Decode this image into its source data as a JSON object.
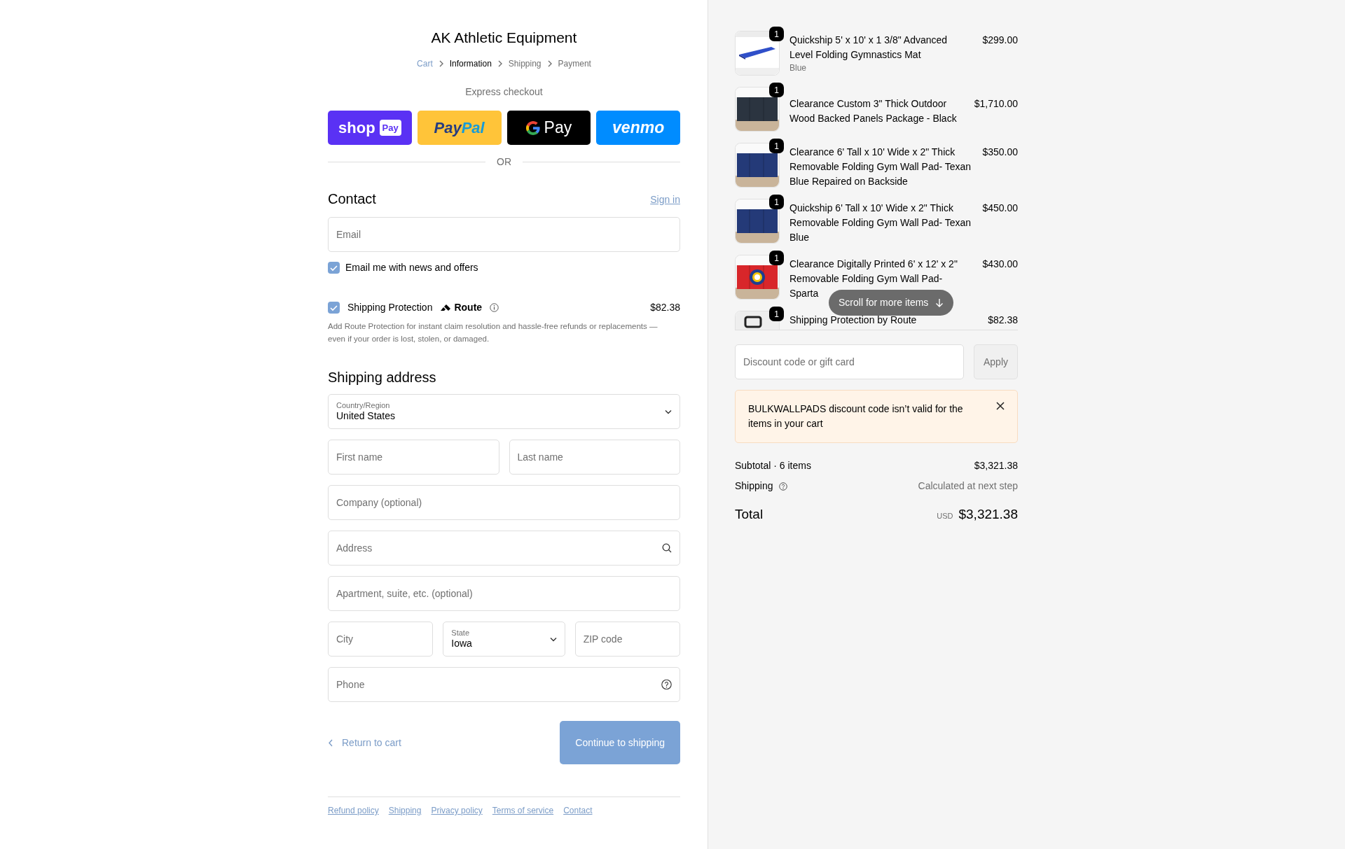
{
  "store": {
    "name": "AK Athletic Equipment"
  },
  "breadcrumb": [
    {
      "label": "Cart",
      "selected": false,
      "link": true
    },
    {
      "label": "Information",
      "selected": true,
      "link": false
    },
    {
      "label": "Shipping",
      "selected": false,
      "link": false
    },
    {
      "label": "Payment",
      "selected": false,
      "link": false
    }
  ],
  "express_checkout": {
    "title": "Express checkout",
    "divider": "OR",
    "buttons": [
      {
        "kind": "shoppay",
        "label": "shop",
        "badge": "Pay"
      },
      {
        "kind": "paypal",
        "label": "Pay",
        "label_2": "Pal"
      },
      {
        "kind": "gpay",
        "label": "Pay"
      },
      {
        "kind": "venmo",
        "label": "venmo"
      }
    ]
  },
  "contact": {
    "title": "Contact",
    "sign_in": "Sign in",
    "email": {
      "placeholder": "Email"
    },
    "newsletter": {
      "label": "Email me with news and offers",
      "checked": true
    }
  },
  "shipping_protection": {
    "label": "Shipping Protection",
    "brand": "Route",
    "price": "$82.38",
    "checked": true,
    "description": "Add Route Protection for instant claim resolution and hassle-free refunds or replacements — even if your order is lost, stolen, or damaged."
  },
  "shipping_address": {
    "title": "Shipping address",
    "rows": [
      [
        {
          "kind": "select",
          "label": "Country/Region",
          "value": "United States"
        }
      ],
      [
        {
          "kind": "text",
          "placeholder": "First name"
        },
        {
          "kind": "text",
          "placeholder": "Last name"
        }
      ],
      [
        {
          "kind": "text",
          "placeholder": "Company (optional)"
        }
      ],
      [
        {
          "kind": "search",
          "placeholder": "Address"
        }
      ],
      [
        {
          "kind": "text",
          "placeholder": "Apartment, suite, etc. (optional)"
        }
      ],
      [
        {
          "kind": "text",
          "placeholder": "City"
        },
        {
          "kind": "select",
          "label": "State",
          "value": "Iowa"
        },
        {
          "kind": "text",
          "placeholder": "ZIP code"
        }
      ],
      [
        {
          "kind": "help",
          "placeholder": "Phone"
        }
      ]
    ]
  },
  "actions": {
    "back": "Return to cart",
    "continue": {
      "label": "Continue to shipping",
      "disabled": true
    }
  },
  "footer_links": [
    "Refund policy",
    "Shipping",
    "Privacy policy",
    "Terms of service",
    "Contact"
  ],
  "order_summary": {
    "items": [
      {
        "title": "Quickship 5' x 10' x 1 3/8\" Advanced Level Folding Gymnastics Mat",
        "variant": "Blue",
        "price": "$299.00",
        "quantity": "1"
      },
      {
        "title": "Clearance Custom 3\" Thick Outdoor Wood Backed Panels Package - Black",
        "price": "$1,710.00",
        "quantity": "1"
      },
      {
        "title": "Clearance 6' Tall x 10' Wide x 2\" Thick Removable Folding Gym Wall Pad- Texan Blue Repaired on Backside",
        "price": "$350.00",
        "quantity": "1"
      },
      {
        "title": "Quickship 6' Tall x 10' Wide x 2\" Thick Removable Folding Gym Wall Pad- Texan Blue",
        "price": "$450.00",
        "quantity": "1"
      },
      {
        "title": "Clearance Digitally Printed 6' x 12' x 2\" Removable Folding Gym Wall Pad- Sparta",
        "price": "$430.00",
        "quantity": "1"
      },
      {
        "title": "Shipping Protection by Route",
        "price": "$82.38",
        "quantity": "1"
      }
    ],
    "scroll_hint": "Scroll for more items",
    "discount": {
      "placeholder": "Discount code or gift card",
      "button": "Apply"
    },
    "alert": {
      "message": "BULKWALLPADS discount code isn’t valid for the items in your cart",
      "dismissible": true
    },
    "subtotal": {
      "label": "Subtotal · 6 items",
      "value": "$3,321.38"
    },
    "shipping": {
      "label": "Shipping",
      "value": "Calculated at next step"
    },
    "total": {
      "label": "Total",
      "currency": "USD",
      "value": "$3,321.38"
    }
  }
}
